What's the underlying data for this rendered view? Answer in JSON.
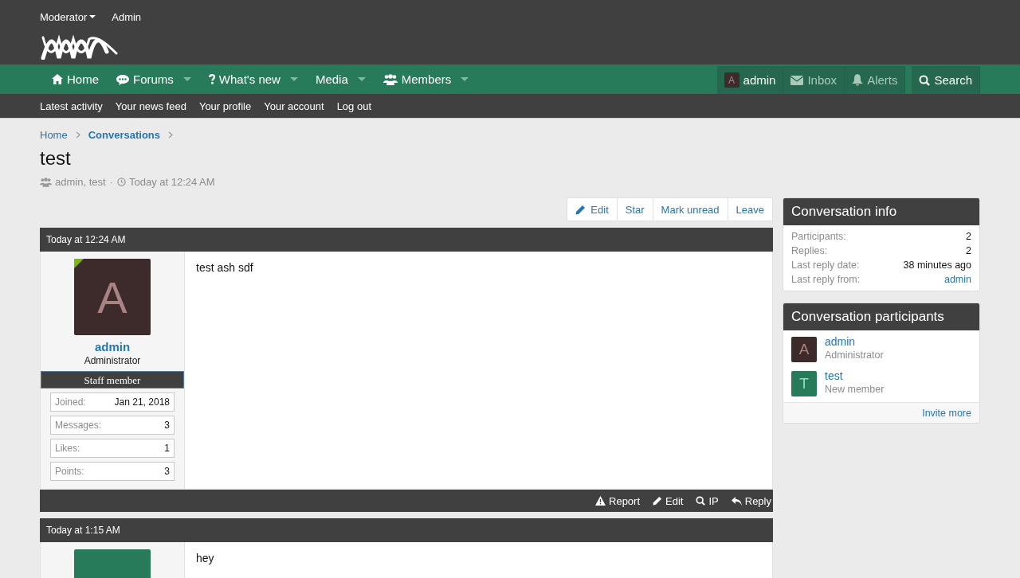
{
  "top_links": [
    {
      "label": "Moderator",
      "has_menu": true
    },
    {
      "label": "Admin",
      "has_menu": false
    }
  ],
  "nav": [
    {
      "label": "Home",
      "has_menu": false
    },
    {
      "label": "Forums",
      "has_menu": true
    },
    {
      "label": "What's new",
      "has_menu": true
    },
    {
      "label": "Media",
      "has_menu": true
    },
    {
      "label": "Members",
      "has_menu": true
    }
  ],
  "account": {
    "avatar_letter": "A",
    "name": "admin"
  },
  "nav_right": [
    {
      "label": "Inbox",
      "muted": true
    },
    {
      "label": "Alerts",
      "muted": true
    },
    {
      "label": "Search",
      "muted": false
    }
  ],
  "subnav": [
    "Latest activity",
    "Your news feed",
    "Your profile",
    "Your account",
    "Log out"
  ],
  "breadcrumbs": [
    {
      "label": "Home",
      "current": false
    },
    {
      "label": "Conversations",
      "current": true
    }
  ],
  "title": "test",
  "meta": {
    "participants": "admin, test",
    "separator": "·",
    "date": "Today at 12:24 AM"
  },
  "actions": [
    "Edit",
    "Star",
    "Mark unread",
    "Leave"
  ],
  "posts": [
    {
      "date": "Today at 12:24 AM",
      "avatar_letter": "A",
      "color": "#3d2a2a",
      "online": true,
      "user": "admin",
      "role": "Administrator",
      "banner": "Staff member",
      "stats": [
        {
          "label": "Joined:",
          "value": "Jan 21, 2018"
        },
        {
          "label": "Messages:",
          "value": "3"
        },
        {
          "label": "Likes:",
          "value": "1"
        },
        {
          "label": "Points:",
          "value": "3"
        }
      ],
      "text": "test ash sdf",
      "footer": [
        "Report",
        "Edit",
        "IP",
        "Reply"
      ]
    },
    {
      "date": "Today at 1:15 AM",
      "color": "#277a5a",
      "online": false,
      "text": "hey"
    }
  ],
  "info": {
    "title": "Conversation info",
    "rows": [
      {
        "label": "Participants:",
        "value": "2",
        "link": false
      },
      {
        "label": "Replies:",
        "value": "2",
        "link": false
      },
      {
        "label": "Last reply date:",
        "value": "38 minutes ago",
        "link": false
      },
      {
        "label": "Last reply from:",
        "value": "admin",
        "link": true
      }
    ]
  },
  "participants": {
    "title": "Conversation participants",
    "people": [
      {
        "letter": "A",
        "color": "#3d2a2a",
        "name": "admin",
        "role": "Administrator"
      },
      {
        "letter": "T",
        "color": "#277a5a",
        "name": "test",
        "role": "New member"
      }
    ],
    "invite": "Invite more"
  }
}
